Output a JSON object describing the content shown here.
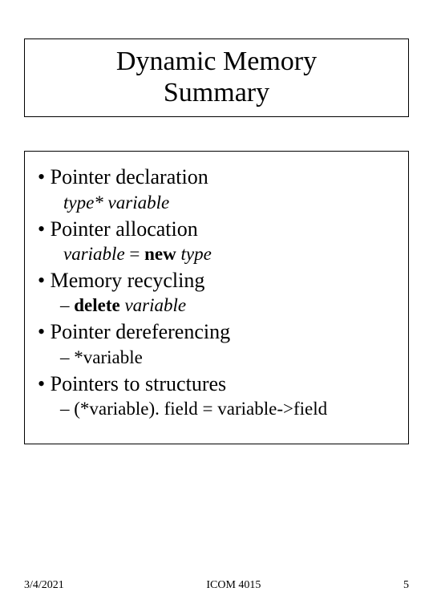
{
  "title_line1": "Dynamic Memory",
  "title_line2": "Summary",
  "items": {
    "pd_label": "Pointer declaration",
    "pd_sub": "type*   variable",
    "pa_label": "Pointer allocation",
    "pa_sub_var": "variable",
    "pa_sub_eq": " = ",
    "pa_sub_new": "new",
    "pa_sub_sp": " ",
    "pa_sub_type": "type",
    "mr_label": "Memory recycling",
    "mr_sub_prefix": "– ",
    "mr_sub_del": "delete",
    "mr_sub_sp": " ",
    "mr_sub_var": "variable",
    "pdr_label": "Pointer dereferencing",
    "pdr_sub": "– *variable",
    "pts_label": "Pointers to structures",
    "pts_sub": "– (*variable). field = variable->field"
  },
  "footer": {
    "date": "3/4/2021",
    "course": "ICOM 4015",
    "pageno": "5"
  }
}
